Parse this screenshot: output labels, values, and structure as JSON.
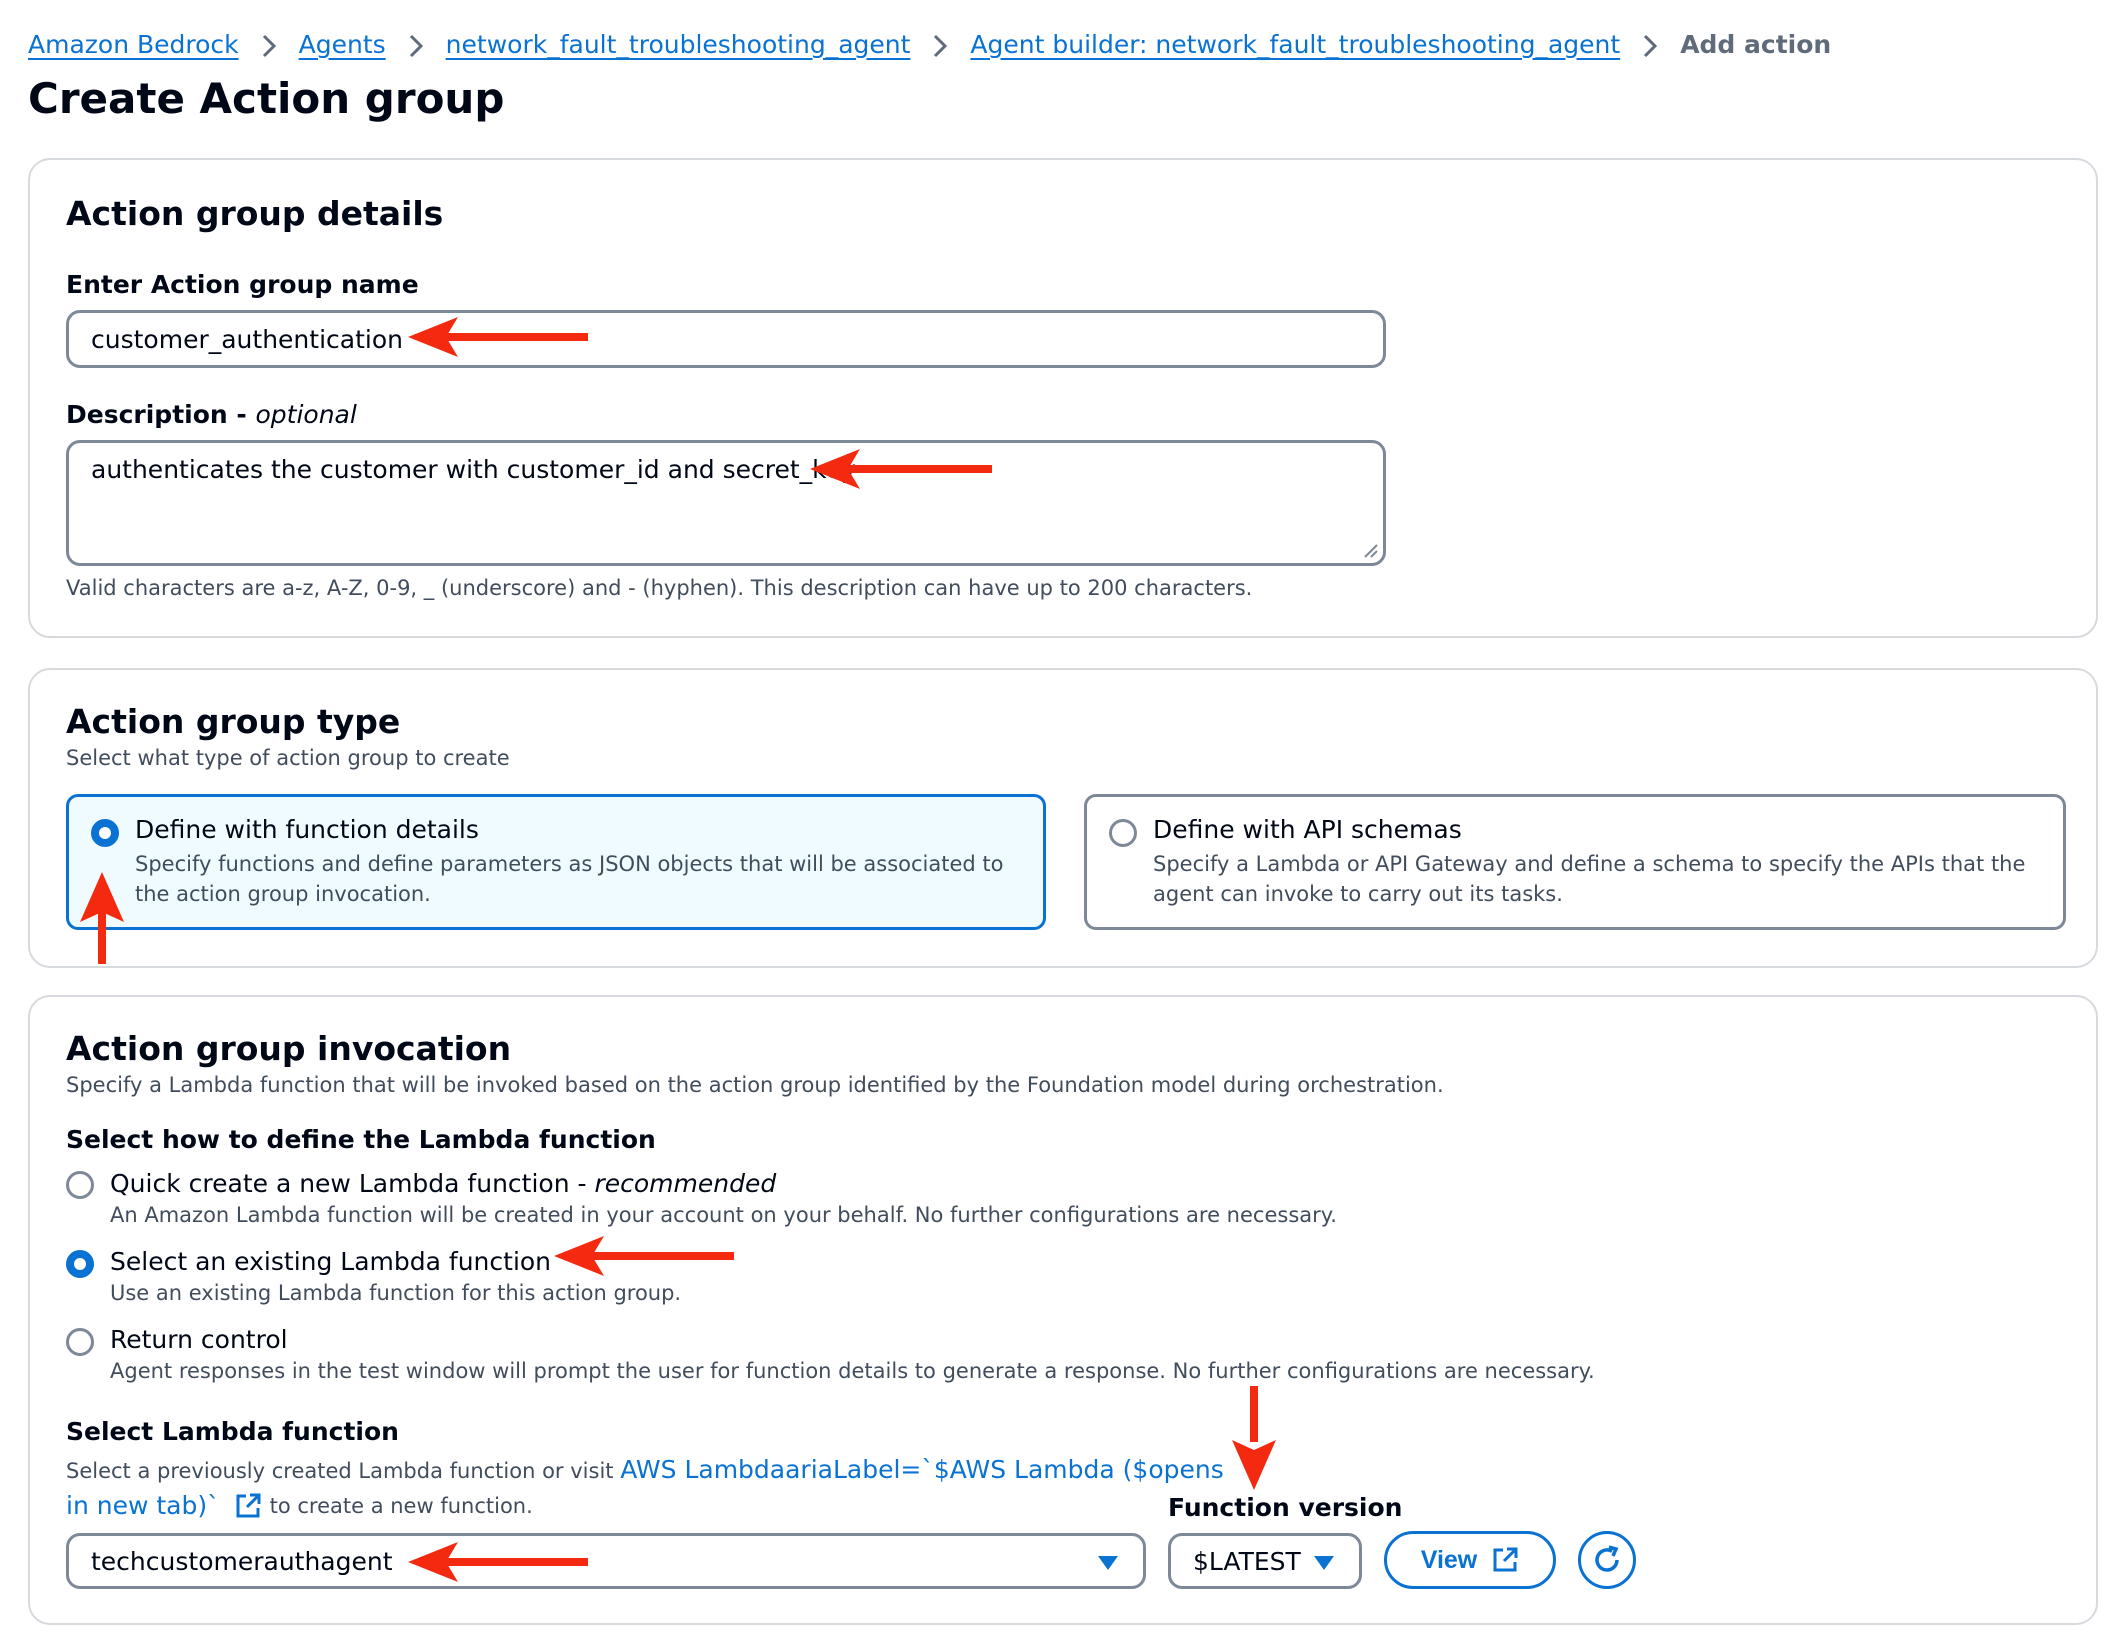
{
  "breadcrumb": {
    "items": [
      {
        "label": "Amazon Bedrock"
      },
      {
        "label": "Agents"
      },
      {
        "label": "network_fault_troubleshooting_agent"
      },
      {
        "label": "Agent builder: network_fault_troubleshooting_agent"
      }
    ],
    "current": "Add action"
  },
  "page": {
    "title": "Create Action group"
  },
  "details": {
    "heading": "Action group details",
    "name_label": "Enter Action group name",
    "name_value": "customer_authentication",
    "description_label": "Description - ",
    "description_optional": "optional",
    "description_value": "authenticates the customer with customer_id and secret_key",
    "description_hint": "Valid characters are a-z, A-Z, 0-9, _ (underscore) and - (hyphen). This description can have up to 200 characters."
  },
  "type": {
    "heading": "Action group type",
    "subtitle": "Select what type of action group to create",
    "options": [
      {
        "title": "Define with function details",
        "description": "Specify functions and define parameters as JSON objects that will be associated to the action group invocation.",
        "selected": true
      },
      {
        "title": "Define with API schemas",
        "description": "Specify a Lambda or API Gateway and define a schema to specify the APIs that the agent can invoke to carry out its tasks.",
        "selected": false
      }
    ]
  },
  "invocation": {
    "heading": "Action group invocation",
    "subtitle": "Specify a Lambda function that will be invoked based on the action group identified by the Foundation model during orchestration.",
    "define_label": "Select how to define the Lambda function",
    "options": [
      {
        "title": "Quick create a new Lambda function - ",
        "title_suffix": "recommended",
        "description": "An Amazon Lambda function will be created in your account on your behalf. No further configurations are necessary.",
        "selected": false
      },
      {
        "title": "Select an existing Lambda function",
        "description": "Use an existing Lambda function for this action group.",
        "selected": true
      },
      {
        "title": "Return control",
        "description": "Agent responses in the test window will prompt the user for function details to generate a response. No further configurations are necessary.",
        "selected": false
      }
    ],
    "lambda_label": "Select Lambda function",
    "lambda_hint_prefix": "Select a previously created Lambda function or visit ",
    "lambda_link_line1": "AWS LambdaariaLabel=`$AWS Lambda ($opens",
    "lambda_link_line2": "in new tab)`",
    "lambda_hint_suffix": "to create a new function.",
    "lambda_value": "techcustomerauthagent",
    "version_label": "Function version",
    "version_value": "$LATEST",
    "view_label": "View"
  },
  "colors": {
    "accent": "#0972d3",
    "annotation_arrow": "#f42a10",
    "border": "#7d8998",
    "panel_border": "#d6dadf"
  },
  "icons": [
    "chevron-right-icon",
    "external-link-icon",
    "caret-down-icon",
    "refresh-icon",
    "annotation-arrow"
  ]
}
